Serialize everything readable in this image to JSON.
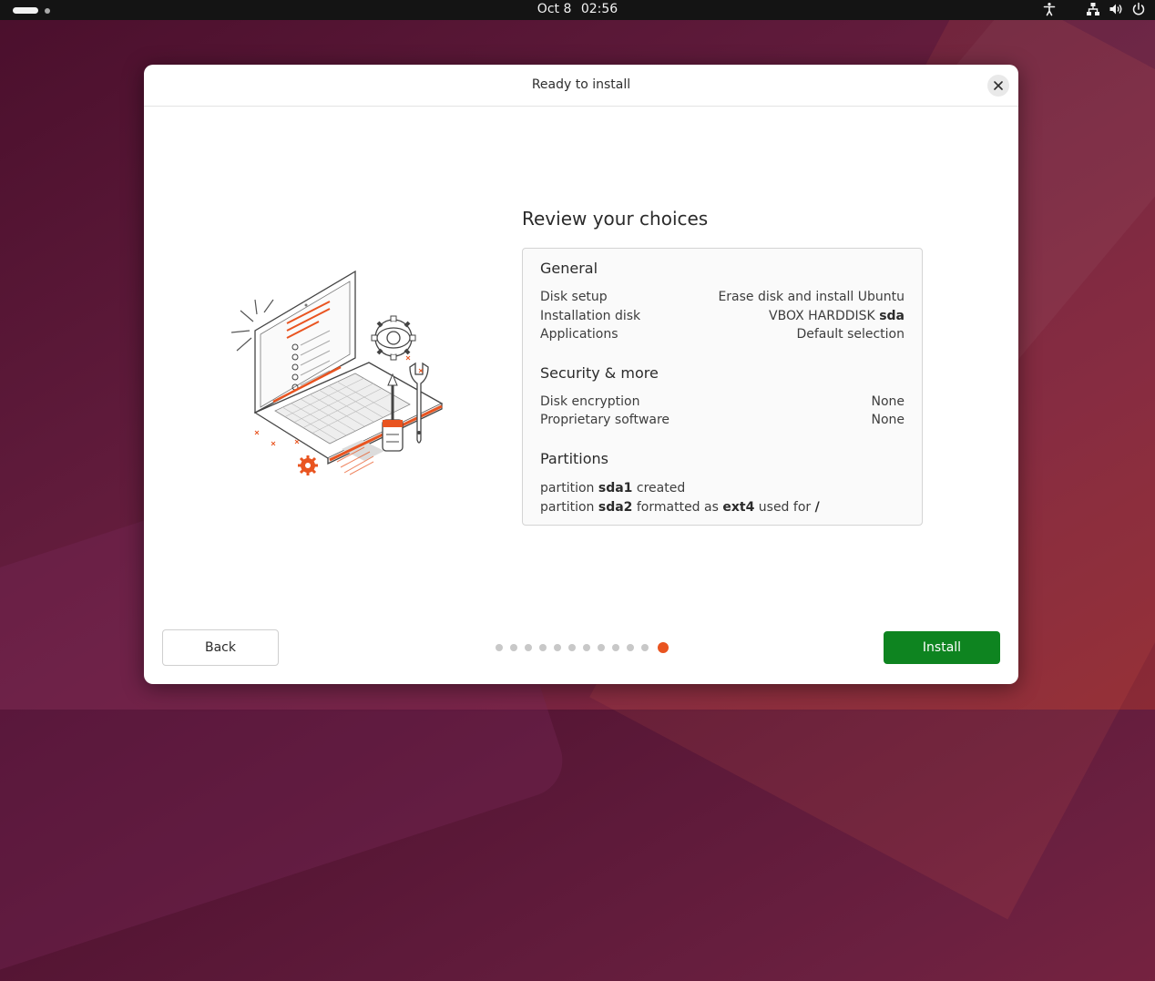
{
  "topbar": {
    "date": "Oct 8",
    "time": "02:56",
    "icons": [
      "accessibility-icon",
      "network-icon",
      "volume-icon",
      "power-icon"
    ]
  },
  "dialog": {
    "title": "Ready to install",
    "heading": "Review your choices",
    "general": {
      "title": "General",
      "rows": [
        {
          "label": "Disk setup",
          "value": "Erase disk and install Ubuntu"
        },
        {
          "label": "Installation disk",
          "value_prefix": "VBOX HARDDISK ",
          "value_bold": "sda"
        },
        {
          "label": "Applications",
          "value": "Default selection"
        }
      ]
    },
    "security": {
      "title": "Security & more",
      "rows": [
        {
          "label": "Disk encryption",
          "value": "None"
        },
        {
          "label": "Proprietary software",
          "value": "None"
        }
      ]
    },
    "partitions": {
      "title": "Partitions",
      "line1": {
        "w1": "partition ",
        "b1": "sda1",
        "w2": " created"
      },
      "line2": {
        "w1": "partition ",
        "b1": "sda2",
        "w2": " formatted as ",
        "b2": "ext4",
        "w3": " used for ",
        "b3": "/"
      }
    },
    "back_label": "Back",
    "install_label": "Install",
    "progress": {
      "total_steps": 12,
      "current_step": 12
    },
    "colors": {
      "accent": "#e95420",
      "install": "#0e8420"
    }
  }
}
